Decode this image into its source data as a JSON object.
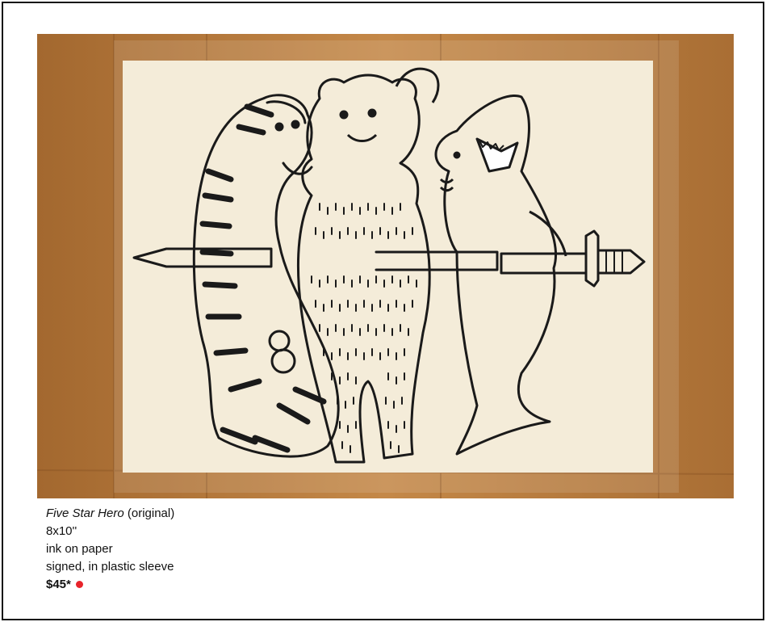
{
  "caption": {
    "title": "Five Star Hero",
    "title_suffix": "(original)",
    "size": "8x10''",
    "medium": "ink on paper",
    "details": "signed, in plastic sleeve",
    "price": "$45*"
  },
  "colors": {
    "wood": "#b57a3c",
    "paper": "#f4ecd9",
    "ink": "#1a1a1a",
    "status_dot": "#e8242b"
  }
}
